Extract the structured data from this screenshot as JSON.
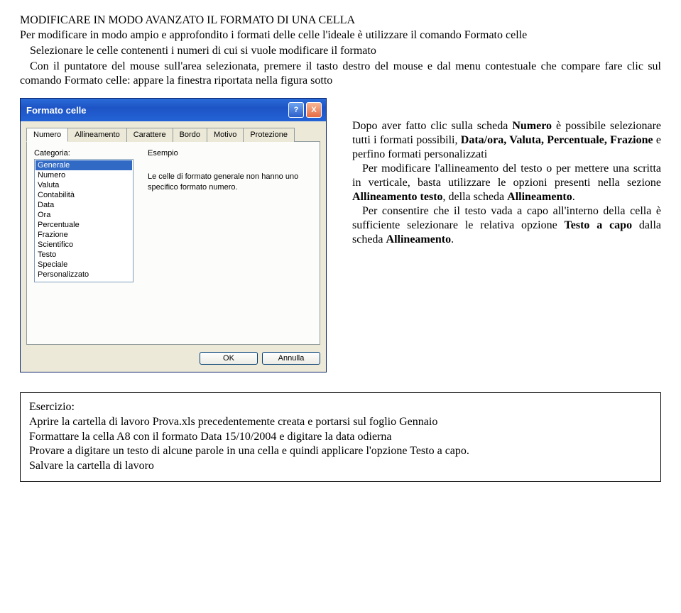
{
  "title": "MODIFICARE IN MODO AVANZATO IL FORMATO DI UNA CELLA",
  "intro": "Per modificare in modo ampio e approfondito i formati delle celle l'ideale è utilizzare il comando Formato celle",
  "bullets": {
    "b1": "Selezionare le celle contenenti i numeri di cui si vuole modificare il formato",
    "b2": "Con il puntatore del mouse sull'area selezionata, premere il tasto destro del mouse e dal menu contestuale che compare fare clic sul comando Formato celle: appare la finestra riportata nella figura sotto"
  },
  "dialog": {
    "title": "Formato celle",
    "help": "?",
    "close": "X",
    "tabs": {
      "numero": "Numero",
      "allineamento": "Allineamento",
      "carattere": "Carattere",
      "bordo": "Bordo",
      "motivo": "Motivo",
      "protezione": "Protezione"
    },
    "category_label": "Categoria:",
    "example_label": "Esempio",
    "example_text": "Le celle di formato generale non hanno uno specifico formato numero.",
    "categories": [
      "Generale",
      "Numero",
      "Valuta",
      "Contabilità",
      "Data",
      "Ora",
      "Percentuale",
      "Frazione",
      "Scientifico",
      "Testo",
      "Speciale",
      "Personalizzato"
    ],
    "ok": "OK",
    "cancel": "Annulla"
  },
  "right": {
    "p1a": "Dopo aver fatto clic sulla scheda ",
    "p1b": "Numero",
    "p1c": " è possibile selezionare tutti i formati possibili, ",
    "p1d": "Data/ora, Valuta, Percentuale, Frazione",
    "p1e": " e perfino formati personalizzati",
    "p2a": "Per modificare l'allineamento del testo o per mettere una scritta in verticale, basta utilizzare le opzioni presenti nella sezione ",
    "p2b": "Allineamento testo",
    "p2c": ", della scheda ",
    "p2d": "Allineamento",
    "p2e": ".",
    "p3a": "Per consentire che il testo vada a capo all'interno della cella è sufficiente selezionare le relativa opzione ",
    "p3b": "Testo a capo",
    "p3c": " dalla scheda ",
    "p3d": "Allineamento",
    "p3e": "."
  },
  "exercise": {
    "title": "Esercizio:",
    "l1": "Aprire la cartella di lavoro Prova.xls precedentemente creata e portarsi sul foglio Gennaio",
    "l2": "Formattare la cella A8 con il formato Data 15/10/2004 e digitare la data odierna",
    "l3": "Provare a digitare un testo di alcune parole in una cella e quindi applicare l'opzione Testo a capo.",
    "l4": "Salvare la cartella di lavoro"
  }
}
